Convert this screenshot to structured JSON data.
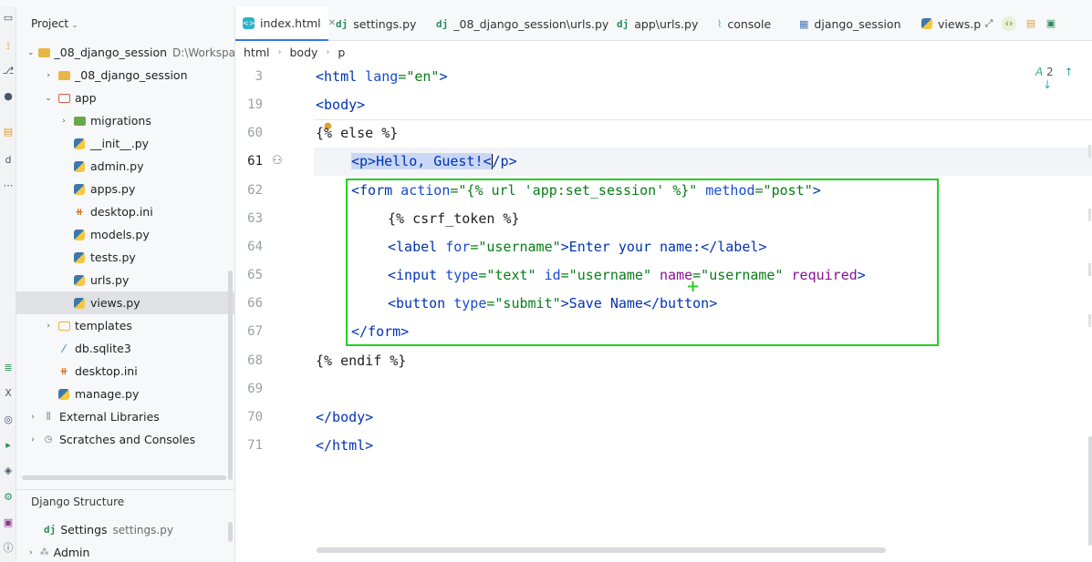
{
  "project_pane": {
    "title": "Project",
    "tree": [
      {
        "label": "_08_django_session",
        "hint": "D:\\Workspac",
        "indent": 0,
        "arrow": "down",
        "icon": "folder-icon"
      },
      {
        "label": "_08_django_session",
        "hint": "",
        "indent": 1,
        "arrow": "right",
        "icon": "folder-icon"
      },
      {
        "label": "app",
        "hint": "",
        "indent": 1,
        "arrow": "down",
        "icon": "folder-red-icon"
      },
      {
        "label": "migrations",
        "hint": "",
        "indent": 2,
        "arrow": "right",
        "icon": "folder-green-icon"
      },
      {
        "label": "__init__.py",
        "hint": "",
        "indent": 2,
        "arrow": "",
        "icon": "python-file-icon"
      },
      {
        "label": "admin.py",
        "hint": "",
        "indent": 2,
        "arrow": "",
        "icon": "python-file-icon"
      },
      {
        "label": "apps.py",
        "hint": "",
        "indent": 2,
        "arrow": "",
        "icon": "python-file-icon"
      },
      {
        "label": "desktop.ini",
        "hint": "",
        "indent": 2,
        "arrow": "",
        "icon": "ini-file-icon"
      },
      {
        "label": "models.py",
        "hint": "",
        "indent": 2,
        "arrow": "",
        "icon": "python-file-icon"
      },
      {
        "label": "tests.py",
        "hint": "",
        "indent": 2,
        "arrow": "",
        "icon": "python-file-icon"
      },
      {
        "label": "urls.py",
        "hint": "",
        "indent": 2,
        "arrow": "",
        "icon": "python-file-icon"
      },
      {
        "label": "views.py",
        "hint": "",
        "indent": 2,
        "arrow": "",
        "icon": "python-file-icon",
        "selected": true
      },
      {
        "label": "templates",
        "hint": "",
        "indent": 1,
        "arrow": "right",
        "icon": "folder-outline-icon"
      },
      {
        "label": "db.sqlite3",
        "hint": "",
        "indent": 1,
        "arrow": "",
        "icon": "database-file-icon"
      },
      {
        "label": "desktop.ini",
        "hint": "",
        "indent": 1,
        "arrow": "",
        "icon": "ini-file-icon"
      },
      {
        "label": "manage.py",
        "hint": "",
        "indent": 1,
        "arrow": "",
        "icon": "python-file-icon"
      },
      {
        "label": "External Libraries",
        "hint": "",
        "indent": 0,
        "arrow": "right",
        "icon": "libraries-icon"
      },
      {
        "label": "Scratches and Consoles",
        "hint": "",
        "indent": 0,
        "arrow": "right",
        "icon": "scratches-icon"
      }
    ]
  },
  "django_structure": {
    "title": "Django Structure",
    "settings_label": "Settings",
    "settings_hint": "settings.py",
    "admin_label": "Admin"
  },
  "tabs": [
    {
      "label": "index.html",
      "icon": "html-file-icon",
      "active": true,
      "closable": true
    },
    {
      "label": "settings.py",
      "icon": "django-icon"
    },
    {
      "label": "_08_django_session\\urls.py",
      "icon": "django-icon"
    },
    {
      "label": "app\\urls.py",
      "icon": "django-icon"
    },
    {
      "label": "console",
      "icon": "console-icon"
    },
    {
      "label": "django_session",
      "icon": "table-icon"
    },
    {
      "label": "views.p",
      "icon": "python-file-icon"
    }
  ],
  "breadcrumb": [
    "html",
    "body",
    "p"
  ],
  "inspection": {
    "count": "2"
  },
  "editor": {
    "current_line": "61",
    "lines": [
      {
        "num": "3"
      },
      {
        "num": "19"
      },
      {
        "num": "60"
      },
      {
        "num": "61"
      },
      {
        "num": "62"
      },
      {
        "num": "63"
      },
      {
        "num": "64"
      },
      {
        "num": "65"
      },
      {
        "num": "66"
      },
      {
        "num": "67"
      },
      {
        "num": "68"
      },
      {
        "num": "69"
      },
      {
        "num": "70"
      },
      {
        "num": "71"
      }
    ],
    "code": {
      "l3_open": "<html",
      "l3_attr": " lang",
      "l3_eq": "=",
      "l3_val": "\"en\"",
      "l3_close": ">",
      "l19": "<body>",
      "l60_a": "{",
      "l60_b": "% else %}",
      "l61_sel": "<p>Hello, Guest!<",
      "l61_rest": "/p>",
      "l62_tag": "<form",
      "l62_a1": " action",
      "l62_v1": "=\"{% url 'app:set_session' %}\"",
      "l62_a2": " method",
      "l62_v2": "=\"post\"",
      "l62_end": ">",
      "l63": "{% csrf_token %}",
      "l64_tag": "<label",
      "l64_a1": " for",
      "l64_v1": "=\"username\"",
      "l64_text": ">Enter your name:</",
      "l64_end": "label>",
      "l65_tag": "<input",
      "l65_a1": " type",
      "l65_v1": "=\"text\"",
      "l65_a2": " id",
      "l65_v2": "=\"username\"",
      "l65_a3": " name",
      "l65_v3": "=\"username\"",
      "l65_a4": " required",
      "l65_end": ">",
      "l66_tag": "<button",
      "l66_a1": " type",
      "l66_v1": "=\"submit\"",
      "l66_text": ">Save Name</",
      "l66_end": "button>",
      "l67": "</form>",
      "l68": "{% endif %}",
      "l70": "</body>",
      "l71": "</html>"
    }
  },
  "colors": {
    "highlight_box": "#1fd11f",
    "selection": "#c9d7f4",
    "tag": "#0033b3",
    "string": "#067d17",
    "attribute": "#871094"
  }
}
